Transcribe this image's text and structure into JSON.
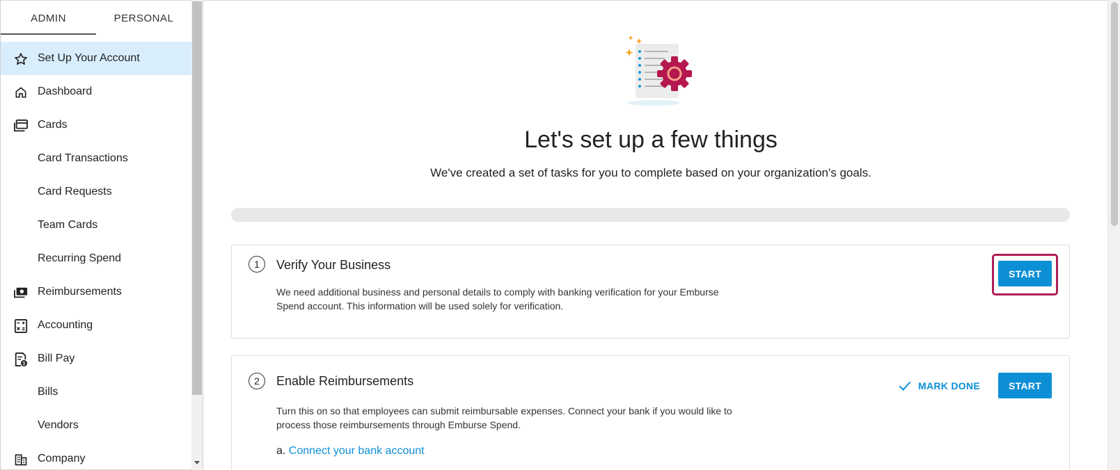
{
  "sidebar": {
    "tabs": [
      {
        "label": "ADMIN",
        "active": true
      },
      {
        "label": "PERSONAL",
        "active": false
      }
    ],
    "items": [
      {
        "label": "Set Up Your Account",
        "icon": "star-icon",
        "active": true
      },
      {
        "label": "Dashboard",
        "icon": "home-icon"
      },
      {
        "label": "Cards",
        "icon": "cards-icon"
      },
      {
        "label": "Card Transactions",
        "icon": ""
      },
      {
        "label": "Card Requests",
        "icon": ""
      },
      {
        "label": "Team Cards",
        "icon": ""
      },
      {
        "label": "Recurring Spend",
        "icon": ""
      },
      {
        "label": "Reimbursements",
        "icon": "cash-icon"
      },
      {
        "label": "Accounting",
        "icon": "calculator-icon"
      },
      {
        "label": "Bill Pay",
        "icon": "bill-icon"
      },
      {
        "label": "Bills",
        "icon": ""
      },
      {
        "label": "Vendors",
        "icon": ""
      },
      {
        "label": "Company",
        "icon": "building-icon"
      }
    ]
  },
  "main": {
    "title": "Let's set up a few things",
    "subtitle": "We've created a set of tasks for you to complete based on your organization's goals.",
    "progress": 0,
    "tasks": [
      {
        "number": "1",
        "title": "Verify Your Business",
        "description": "We need additional business and personal details to comply with banking verification for your Emburse Spend account. This information will be used solely for verification.",
        "start_label": "START"
      },
      {
        "number": "2",
        "title": "Enable Reimbursements",
        "description": "Turn this on so that employees can submit reimbursable expenses. Connect your bank if you would like to process those reimbursements through Emburse Spend.",
        "mark_done_label": "MARK DONE",
        "start_label": "START",
        "step_prefix": "a.",
        "step_link": "Connect your bank account"
      }
    ]
  },
  "colors": {
    "accent": "#0d8fd6",
    "active_nav_bg": "#d8eefc",
    "focus_ring": "#b01e57",
    "gear": "#b5174f"
  }
}
